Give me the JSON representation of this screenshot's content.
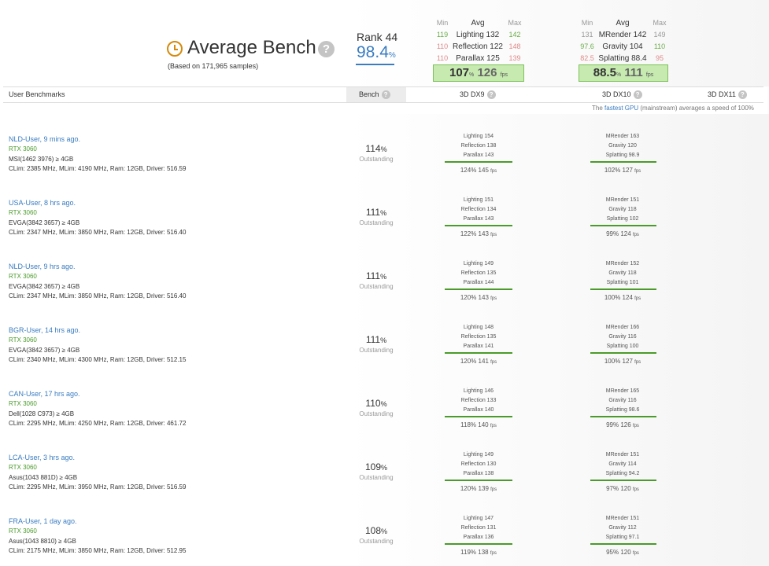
{
  "header": {
    "title": "Average Bench",
    "samples": "(Based on 171,965 samples)",
    "rank_label": "Rank 44",
    "rank_value": "98.4",
    "rank_unit": "%",
    "dx9": {
      "min_h": "Min",
      "avg_h": "Avg",
      "max_h": "Max",
      "rows": [
        {
          "min": "119",
          "avg": "Lighting 132",
          "max": "142"
        },
        {
          "min": "110",
          "avg": "Reflection 122",
          "max": "148"
        },
        {
          "min": "110",
          "avg": "Parallax 125",
          "max": "139"
        }
      ],
      "total_pct": "107",
      "total_fps": "126",
      "pct_sign": "%",
      "fps_unit": "fps"
    },
    "dx10": {
      "min_h": "Min",
      "avg_h": "Avg",
      "max_h": "Max",
      "rows": [
        {
          "min": "131",
          "avg": "MRender 142",
          "max": "149"
        },
        {
          "min": "97.6",
          "avg": "Gravity 104",
          "max": "110"
        },
        {
          "min": "82.5",
          "avg": "Splatting 88.4",
          "max": "95"
        }
      ],
      "total_pct": "88.5",
      "total_fps": "111",
      "pct_sign": "%",
      "fps_unit": "fps"
    }
  },
  "columns": {
    "user": "User Benchmarks",
    "bench": "Bench",
    "dx9": "3D DX9",
    "dx10": "3D DX10",
    "dx11": "3D DX11"
  },
  "fastest_note": {
    "pre": "The ",
    "link": "fastest GPU",
    "post": " (mainstream) averages a speed of 100%"
  },
  "rows": [
    {
      "user": "NLD-User, 9 mins ago.",
      "gpu": "RTX 3060",
      "board": "MSI(1462 3976) ≥ 4GB",
      "clock": "CLim: 2385 MHz, MLim: 4190 MHz, Ram: 12GB, Driver: 516.59",
      "pct": "114",
      "rating": "Outstanding",
      "dx9": [
        "Lighting 154",
        "Reflection 138",
        "Parallax 143"
      ],
      "dx9_total": "124% 145",
      "dx10": [
        "MRender 163",
        "Gravity 120",
        "Splatting 98.9"
      ],
      "dx10_total": "102% 127"
    },
    {
      "user": "USA-User, 8 hrs ago.",
      "gpu": "RTX 3060",
      "board": "EVGA(3842 3657) ≥ 4GB",
      "clock": "CLim: 2347 MHz, MLim: 3850 MHz, Ram: 12GB, Driver: 516.40",
      "pct": "111",
      "rating": "Outstanding",
      "dx9": [
        "Lighting 151",
        "Reflection 134",
        "Parallax 143"
      ],
      "dx9_total": "122% 143",
      "dx10": [
        "MRender 151",
        "Gravity 118",
        "Splatting 102"
      ],
      "dx10_total": "99% 124"
    },
    {
      "user": "NLD-User, 9 hrs ago.",
      "gpu": "RTX 3060",
      "board": "EVGA(3842 3657) ≥ 4GB",
      "clock": "CLim: 2347 MHz, MLim: 3850 MHz, Ram: 12GB, Driver: 516.40",
      "pct": "111",
      "rating": "Outstanding",
      "dx9": [
        "Lighting 149",
        "Reflection 135",
        "Parallax 144"
      ],
      "dx9_total": "120% 143",
      "dx10": [
        "MRender 152",
        "Gravity 118",
        "Splatting 101"
      ],
      "dx10_total": "100% 124"
    },
    {
      "user": "BGR-User, 14 hrs ago.",
      "gpu": "RTX 3060",
      "board": "EVGA(3842 3657) ≥ 4GB",
      "clock": "CLim: 2340 MHz, MLim: 4300 MHz, Ram: 12GB, Driver: 512.15",
      "pct": "111",
      "rating": "Outstanding",
      "dx9": [
        "Lighting 148",
        "Reflection 135",
        "Parallax 141"
      ],
      "dx9_total": "120% 141",
      "dx10": [
        "MRender 166",
        "Gravity 116",
        "Splatting 100"
      ],
      "dx10_total": "100% 127"
    },
    {
      "user": "CAN-User, 17 hrs ago.",
      "gpu": "RTX 3060",
      "board": "Dell(1028 C973) ≥ 4GB",
      "clock": "CLim: 2295 MHz, MLim: 4250 MHz, Ram: 12GB, Driver: 461.72",
      "pct": "110",
      "rating": "Outstanding",
      "dx9": [
        "Lighting 146",
        "Reflection 133",
        "Parallax 140"
      ],
      "dx9_total": "118% 140",
      "dx10": [
        "MRender 165",
        "Gravity 116",
        "Splatting 98.6"
      ],
      "dx10_total": "99% 126"
    },
    {
      "user": "LCA-User, 3 hrs ago.",
      "gpu": "RTX 3060",
      "board": "Asus(1043 881D) ≥ 4GB",
      "clock": "CLim: 2295 MHz, MLim: 3950 MHz, Ram: 12GB, Driver: 516.59",
      "pct": "109",
      "rating": "Outstanding",
      "dx9": [
        "Lighting 149",
        "Reflection 130",
        "Parallax 138"
      ],
      "dx9_total": "120% 139",
      "dx10": [
        "MRender 151",
        "Gravity 114",
        "Splatting 94.2"
      ],
      "dx10_total": "97% 120"
    },
    {
      "user": "FRA-User, 1 day ago.",
      "gpu": "RTX 3060",
      "board": "Asus(1043 8810) ≥ 4GB",
      "clock": "CLim: 2175 MHz, MLim: 3850 MHz, Ram: 12GB, Driver: 512.95",
      "pct": "108",
      "rating": "Outstanding",
      "dx9": [
        "Lighting 147",
        "Reflection 131",
        "Parallax 136"
      ],
      "dx9_total": "119% 138",
      "dx10": [
        "MRender 151",
        "Gravity 112",
        "Splatting 97.1"
      ],
      "dx10_total": "95% 120"
    }
  ],
  "units": {
    "pct": "%",
    "fps": "fps"
  },
  "colors": {
    "link": "#3a7cc1",
    "gpu": "#4a9b2a",
    "good_box": "#c6eab0",
    "bar": "#4a9b2a",
    "clock_icon": "#d58a0c"
  },
  "icons": {
    "title": "clock-icon",
    "help": "question-help-icon"
  }
}
